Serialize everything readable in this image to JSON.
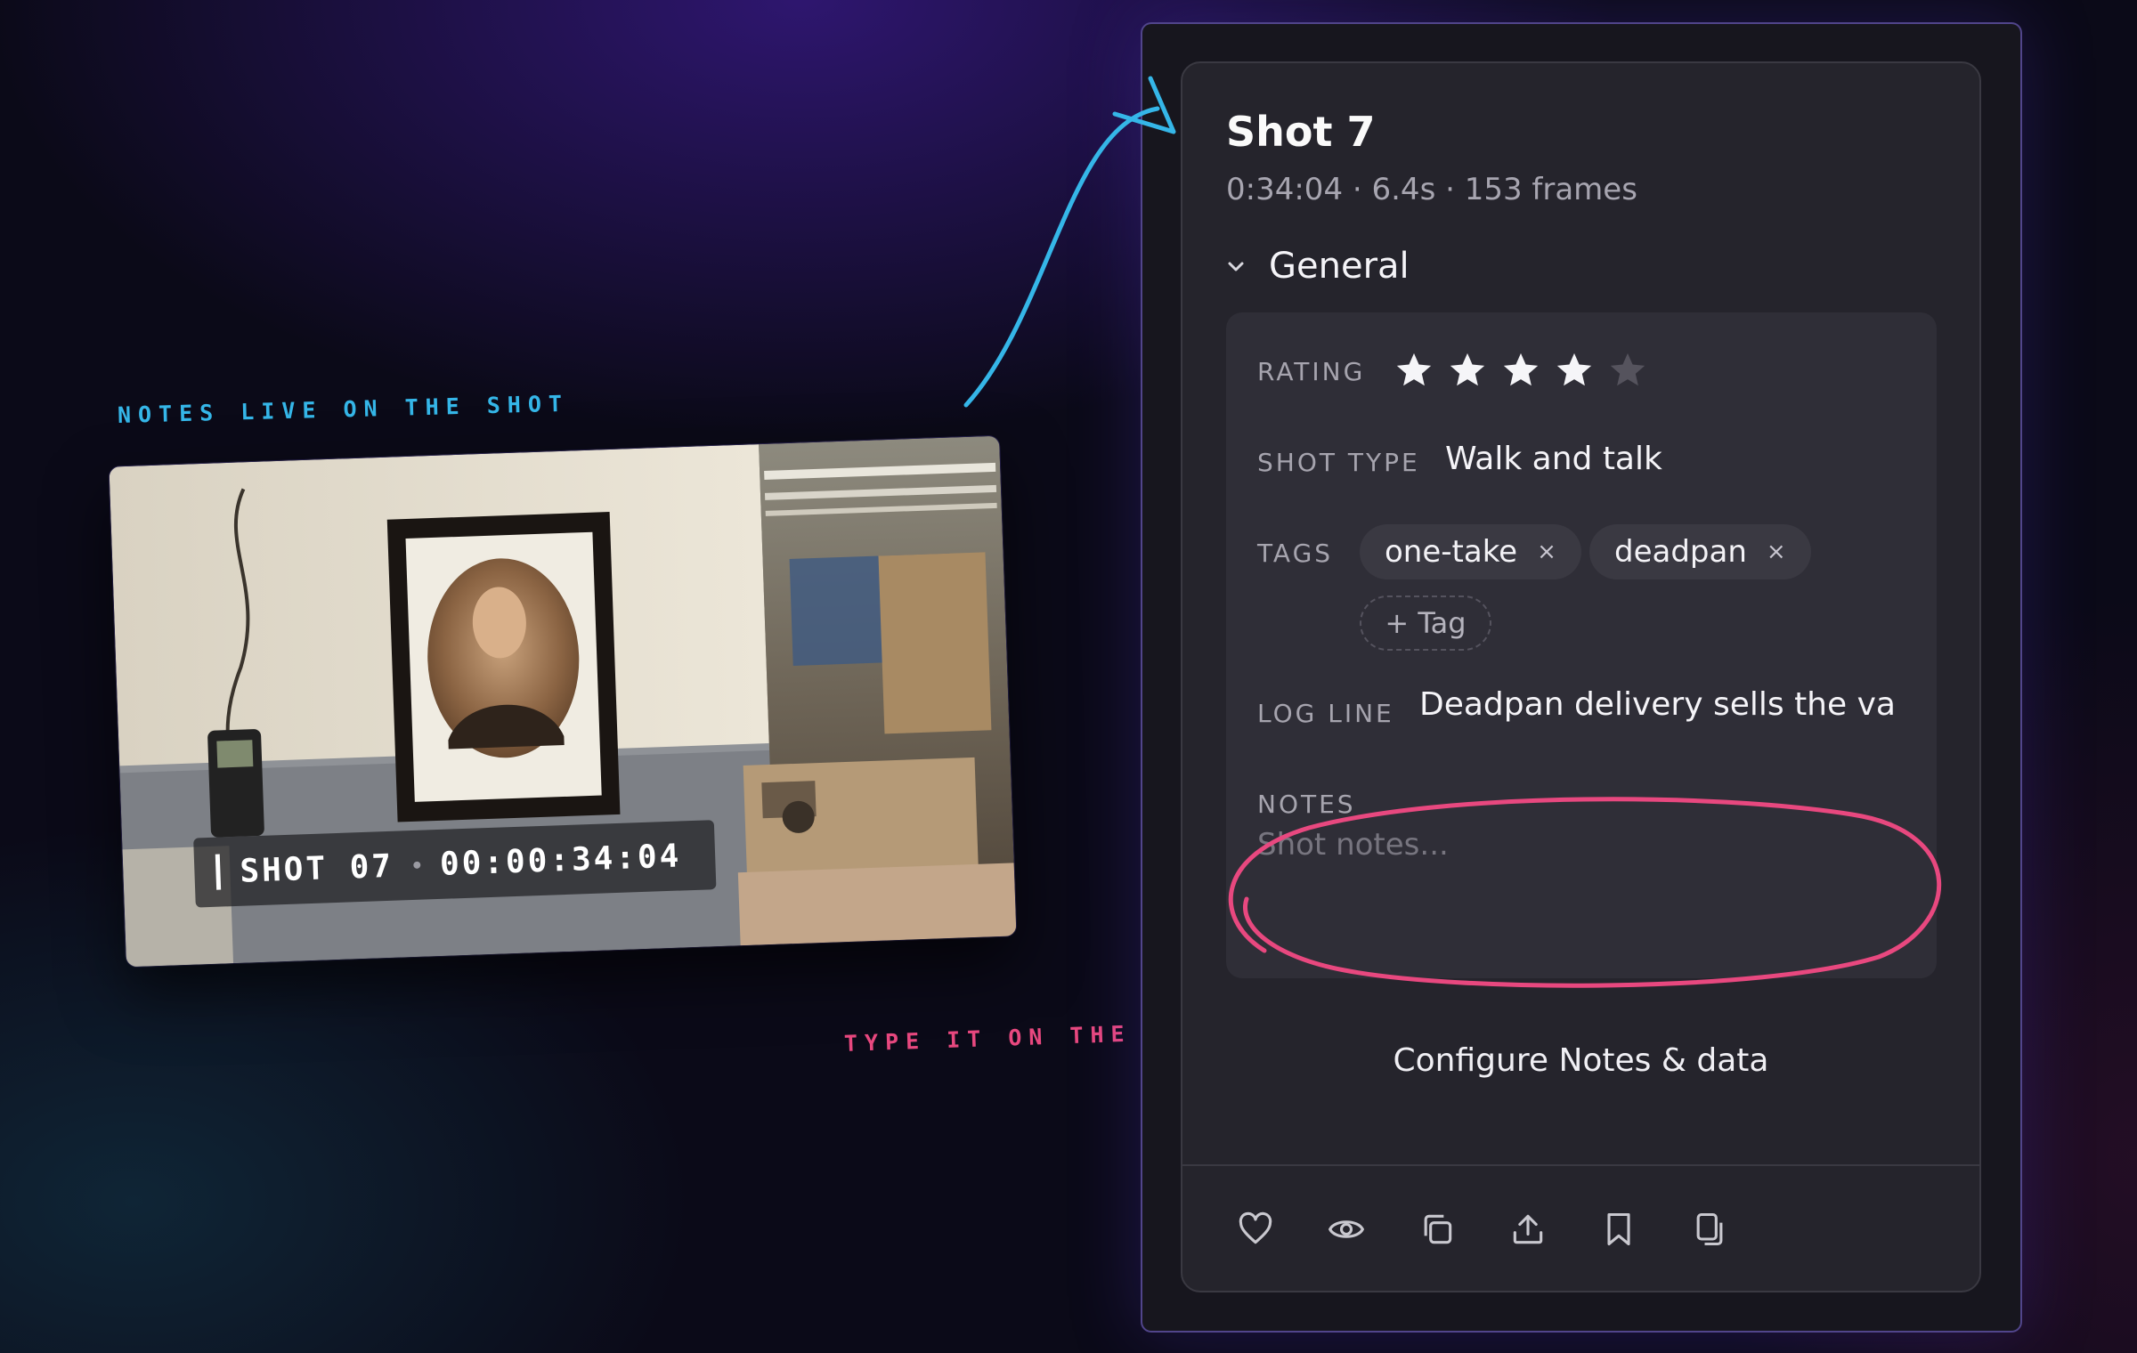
{
  "captions": {
    "notes_live": "NOTES LIVE ON THE SHOT",
    "type_it": "TYPE IT ON THE SHOT"
  },
  "video": {
    "shot_label": "SHOT 07",
    "timecode": "00:00:34:04"
  },
  "panel": {
    "title": "Shot 7",
    "meta": "0:34:04 · 6.4s · 153 frames",
    "section_title": "General",
    "rating_label": "RATING",
    "rating_value": 4,
    "rating_max": 5,
    "shot_type_label": "SHOT TYPE",
    "shot_type_value": "Walk and talk",
    "tags_label": "TAGS",
    "tags": [
      "one-take",
      "deadpan"
    ],
    "tag_remove_glyph": "×",
    "add_tag_label": "+ Tag",
    "log_line_label": "LOG LINE",
    "log_line_value": "Deadpan delivery sells the value",
    "notes_label": "NOTES",
    "notes_placeholder": "Shot notes...",
    "configure_label": "Configure Notes & data"
  },
  "toolbar": {
    "icons": [
      "heart-icon",
      "eye-icon",
      "copy-icon",
      "upload-icon",
      "bookmark-icon",
      "duplicate-icon"
    ]
  },
  "colors": {
    "accent_blue": "#35b6e8",
    "accent_pink": "#e8487f",
    "panel_bg": "#25242c",
    "star_on": "#f5f5f8",
    "star_off": "#55535d"
  }
}
